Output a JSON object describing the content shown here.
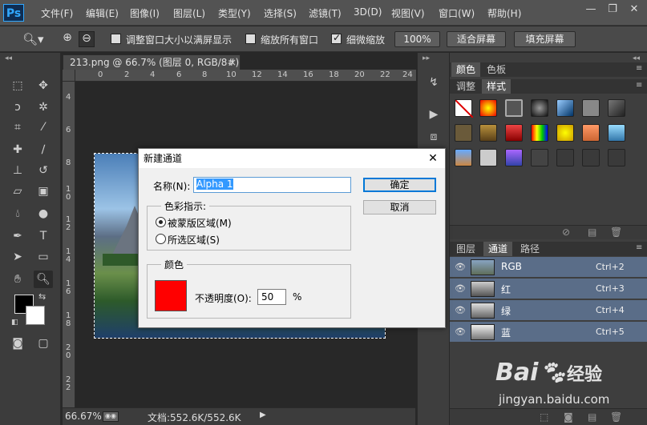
{
  "app": {
    "logo": "Ps"
  },
  "menu": [
    "文件(F)",
    "编辑(E)",
    "图像(I)",
    "图层(L)",
    "类型(Y)",
    "选择(S)",
    "滤镜(T)",
    "3D(D)",
    "视图(V)",
    "窗口(W)",
    "帮助(H)"
  ],
  "window_controls": {
    "minimize": "—",
    "restore": "❐",
    "close": "✕"
  },
  "options": {
    "resize_windows_label": "调整窗口大小以满屏显示",
    "resize_windows_checked": false,
    "zoom_all_label": "缩放所有窗口",
    "zoom_all_checked": false,
    "scrubby_zoom_label": "细微缩放",
    "scrubby_zoom_checked": true,
    "btn_100": "100%",
    "btn_fit": "适合屏幕",
    "btn_fill": "填充屏幕"
  },
  "document": {
    "tab_title": "213.png @ 66.7% (图层 0, RGB/8#)",
    "tab_close": "×",
    "ruler_top_ticks": [
      "0",
      "2",
      "4",
      "6",
      "8",
      "10",
      "12",
      "14",
      "16",
      "18",
      "20",
      "22",
      "24"
    ],
    "ruler_left_ticks": [
      "4",
      "6",
      "8",
      "1\n0",
      "1\n2",
      "1\n4",
      "1\n6",
      "1\n8",
      "2\n0",
      "2\n2"
    ],
    "status_zoom": "66.67%",
    "status_doc": "文档:552.6K/552.6K"
  },
  "panels": {
    "top_tabs": [
      "颜色",
      "色板"
    ],
    "second_tabs": [
      "调整",
      "样式"
    ],
    "layer_tabs": [
      "图层",
      "通道",
      "路径"
    ],
    "channels": [
      {
        "name": "RGB",
        "shortcut": "Ctrl+2"
      },
      {
        "name": "红",
        "shortcut": "Ctrl+3"
      },
      {
        "name": "绿",
        "shortcut": "Ctrl+4"
      },
      {
        "name": "蓝",
        "shortcut": "Ctrl+5"
      }
    ]
  },
  "dialog": {
    "title": "新建通道",
    "name_label": "名称(N):",
    "name_value": "Alpha 1",
    "ok": "确定",
    "cancel": "取消",
    "color_indicates_label": "色彩指示:",
    "radio_masked": "被蒙版区域(M)",
    "radio_selected": "所选区域(S)",
    "color_group_label": "颜色",
    "color_value": "#ff0000",
    "opacity_label": "不透明度(O):",
    "opacity_value": "50",
    "percent": "%"
  },
  "watermark": {
    "brand": "Bai",
    "brand_suffix": "经验",
    "url": "jingyan.baidu.com"
  },
  "colors": {
    "accent": "#31a8ff",
    "selected_channel": "#5a6d88",
    "dialog_bg": "#f0f0f0"
  }
}
